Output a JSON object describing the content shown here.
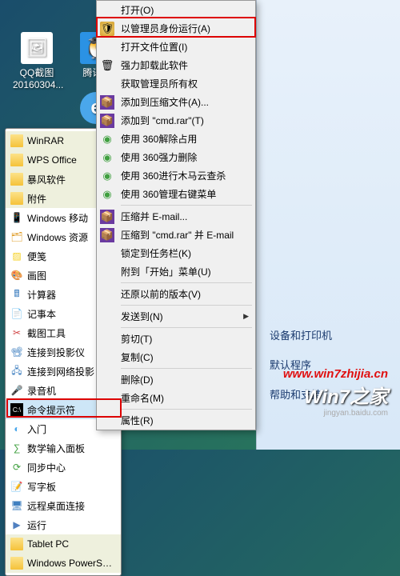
{
  "desktop": {
    "qqshot_label": "QQ截图\n20160304...",
    "qq_label": "腾讯Q"
  },
  "start": {
    "items": [
      "WinRAR",
      "WPS Office",
      "暴风软件",
      "附件",
      "Windows 移动",
      "Windows 资源",
      "便笺",
      "画图",
      "计算器",
      "记事本",
      "截图工具",
      "连接到投影仪",
      "连接到网络投影",
      "录音机",
      "命令提示符",
      "入门",
      "数学输入面板",
      "同步中心",
      "写字板",
      "远程桌面连接",
      "运行",
      "Tablet PC",
      "Windows PowerShell"
    ]
  },
  "ctx": {
    "open": "打开(O)",
    "runas": "以管理员身份运行(A)",
    "openloc": "打开文件位置(I)",
    "uninstall": "强力卸载此软件",
    "getpriv": "获取管理员所有权",
    "addarch": "添加到压缩文件(A)...",
    "addcmd": "添加到 \"cmd.rar\"(T)",
    "use360del": "使用 360解除占用",
    "use360force": "使用 360强力删除",
    "use360horse": "使用 360进行木马云查杀",
    "use360menu": "使用 360管理右键菜单",
    "zipmail": "压缩并 E-mail...",
    "zipcmdmail": "压缩到 \"cmd.rar\" 并 E-mail",
    "pintask": "锁定到任务栏(K)",
    "pinstart": "附到「开始」菜单(U)",
    "restore": "还原以前的版本(V)",
    "sendto": "发送到(N)",
    "cut": "剪切(T)",
    "copy": "复制(C)",
    "delete": "删除(D)",
    "rename": "重命名(M)",
    "props": "属性(R)"
  },
  "right": {
    "devices": "设备和打印机",
    "defaults": "默认程序",
    "help": "帮助和支持"
  },
  "wm": {
    "url": "www.win7zhijia.cn",
    "brand": "Win7之家",
    "sub": "jingyan.baidu.com"
  },
  "icons": {
    "folder": "📁",
    "app": "■",
    "cmd": "▮",
    "arrow": "▶"
  }
}
